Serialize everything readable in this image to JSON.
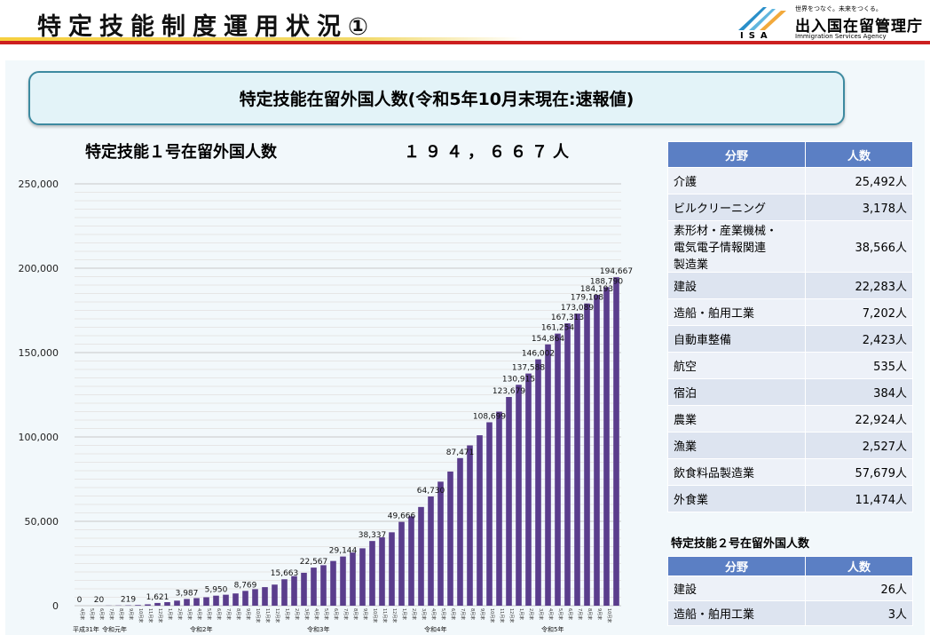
{
  "header": {
    "title": "特定技能制度運用状況①",
    "logo_tagline": "世界をつなぐ。未来をつくる。",
    "logo_name": "出入国在留管理庁",
    "logo_en": "Immigration Services Agency",
    "logo_abbr": "ISA"
  },
  "banner": "特定技能在留外国人数(令和5年10月末現在:速報値)",
  "summary": {
    "label": "特定技能１号在留外国人数",
    "value": "１９４，６６７人"
  },
  "chart_data": {
    "type": "bar",
    "ylim": [
      0,
      250000
    ],
    "yticks": [
      0,
      50000,
      100000,
      150000,
      200000,
      250000
    ],
    "ytick_labels": [
      "0",
      "50,000",
      "100,000",
      "150,000",
      "200,000",
      "250,000"
    ],
    "grid": true,
    "bar_color": "#5a3d8c",
    "categories": [
      "4月末",
      "5月末",
      "6月末",
      "7月末",
      "8月末",
      "9月末",
      "10月末",
      "11月末",
      "12月末",
      "1月末",
      "2月末",
      "3月末",
      "4月末",
      "5月末",
      "6月末",
      "7月末",
      "8月末",
      "9月末",
      "10月末",
      "11月末",
      "12月末",
      "1月末",
      "2月末",
      "3月末",
      "4月末",
      "5月末",
      "6月末",
      "7月末",
      "8月末",
      "9月末",
      "10月末",
      "11月末",
      "12月末",
      "1月末",
      "2月末",
      "3月末",
      "4月末",
      "5月末",
      "6月末",
      "7月末",
      "8月末",
      "9月末",
      "10月末",
      "11月末",
      "12月末",
      "1月末",
      "2月末",
      "3月末",
      "4月末",
      "5月末",
      "6月末",
      "7月末",
      "8月末",
      "9月末",
      "10月末"
    ],
    "values": [
      0,
      0,
      20,
      100,
      150,
      219,
      400,
      800,
      1621,
      2100,
      2994,
      3987,
      4500,
      5000,
      5950,
      6500,
      7250,
      8769,
      9800,
      11000,
      12500,
      15663,
      17500,
      19500,
      22567,
      24000,
      26500,
      29144,
      31500,
      34000,
      38337,
      40500,
      43500,
      49666,
      53000,
      58500,
      64730,
      73500,
      79500,
      87471,
      95000,
      101000,
      108699,
      115000,
      123679,
      130915,
      137588,
      146002,
      154864,
      161254,
      167313,
      173089,
      179108,
      184193,
      188790,
      194667
    ],
    "data_labels": [
      {
        "i": 0,
        "text": "0"
      },
      {
        "i": 2,
        "text": "20"
      },
      {
        "i": 5,
        "text": "219"
      },
      {
        "i": 8,
        "text": "1,621"
      },
      {
        "i": 11,
        "text": "3,987"
      },
      {
        "i": 14,
        "text": "5,950"
      },
      {
        "i": 17,
        "text": "8,769"
      },
      {
        "i": 21,
        "text": "15,663"
      },
      {
        "i": 24,
        "text": "22,567"
      },
      {
        "i": 27,
        "text": "29,144"
      },
      {
        "i": 30,
        "text": "38,337"
      },
      {
        "i": 33,
        "text": "49,666"
      },
      {
        "i": 36,
        "text": "64,730"
      },
      {
        "i": 39,
        "text": "87,471"
      },
      {
        "i": 42,
        "text": "108,699"
      },
      {
        "i": 44,
        "text": "123,679"
      },
      {
        "i": 45,
        "text": "130,915"
      },
      {
        "i": 46,
        "text": "137,588"
      },
      {
        "i": 47,
        "text": "146,002"
      },
      {
        "i": 48,
        "text": "154,864"
      },
      {
        "i": 49,
        "text": "161,254"
      },
      {
        "i": 50,
        "text": "167,313"
      },
      {
        "i": 51,
        "text": "173,089"
      },
      {
        "i": 52,
        "text": "179,108"
      },
      {
        "i": 53,
        "text": "184,193"
      },
      {
        "i": 54,
        "text": "188,790"
      },
      {
        "i": 55,
        "text": "194,667"
      }
    ],
    "year_labels": [
      {
        "text": "平成31年",
        "i": 0
      },
      {
        "text": "令和元年",
        "i": 3
      },
      {
        "text": "令和2年",
        "i": 12
      },
      {
        "text": "令和3年",
        "i": 24
      },
      {
        "text": "令和4年",
        "i": 36
      },
      {
        "text": "令和5年",
        "i": 48
      }
    ]
  },
  "table1": {
    "headers": [
      "分野",
      "人数"
    ],
    "rows": [
      {
        "field": "介護",
        "count": "25,492人"
      },
      {
        "field": "ビルクリーニング",
        "count": "3,178人"
      },
      {
        "field": "素形材・産業機械・\n電気電子情報関連\n製造業",
        "count": "38,566人"
      },
      {
        "field": "建設",
        "count": "22,283人"
      },
      {
        "field": "造船・舶用工業",
        "count": "7,202人"
      },
      {
        "field": "自動車整備",
        "count": "2,423人"
      },
      {
        "field": "航空",
        "count": "535人"
      },
      {
        "field": "宿泊",
        "count": "384人"
      },
      {
        "field": "農業",
        "count": "22,924人"
      },
      {
        "field": "漁業",
        "count": "2,527人"
      },
      {
        "field": "飲食料品製造業",
        "count": "57,679人"
      },
      {
        "field": "外食業",
        "count": "11,474人"
      }
    ]
  },
  "table2_title": "特定技能２号在留外国人数",
  "table2": {
    "headers": [
      "分野",
      "人数"
    ],
    "rows": [
      {
        "field": "建設",
        "count": "26人"
      },
      {
        "field": "造船・舶用工業",
        "count": "3人"
      }
    ]
  }
}
